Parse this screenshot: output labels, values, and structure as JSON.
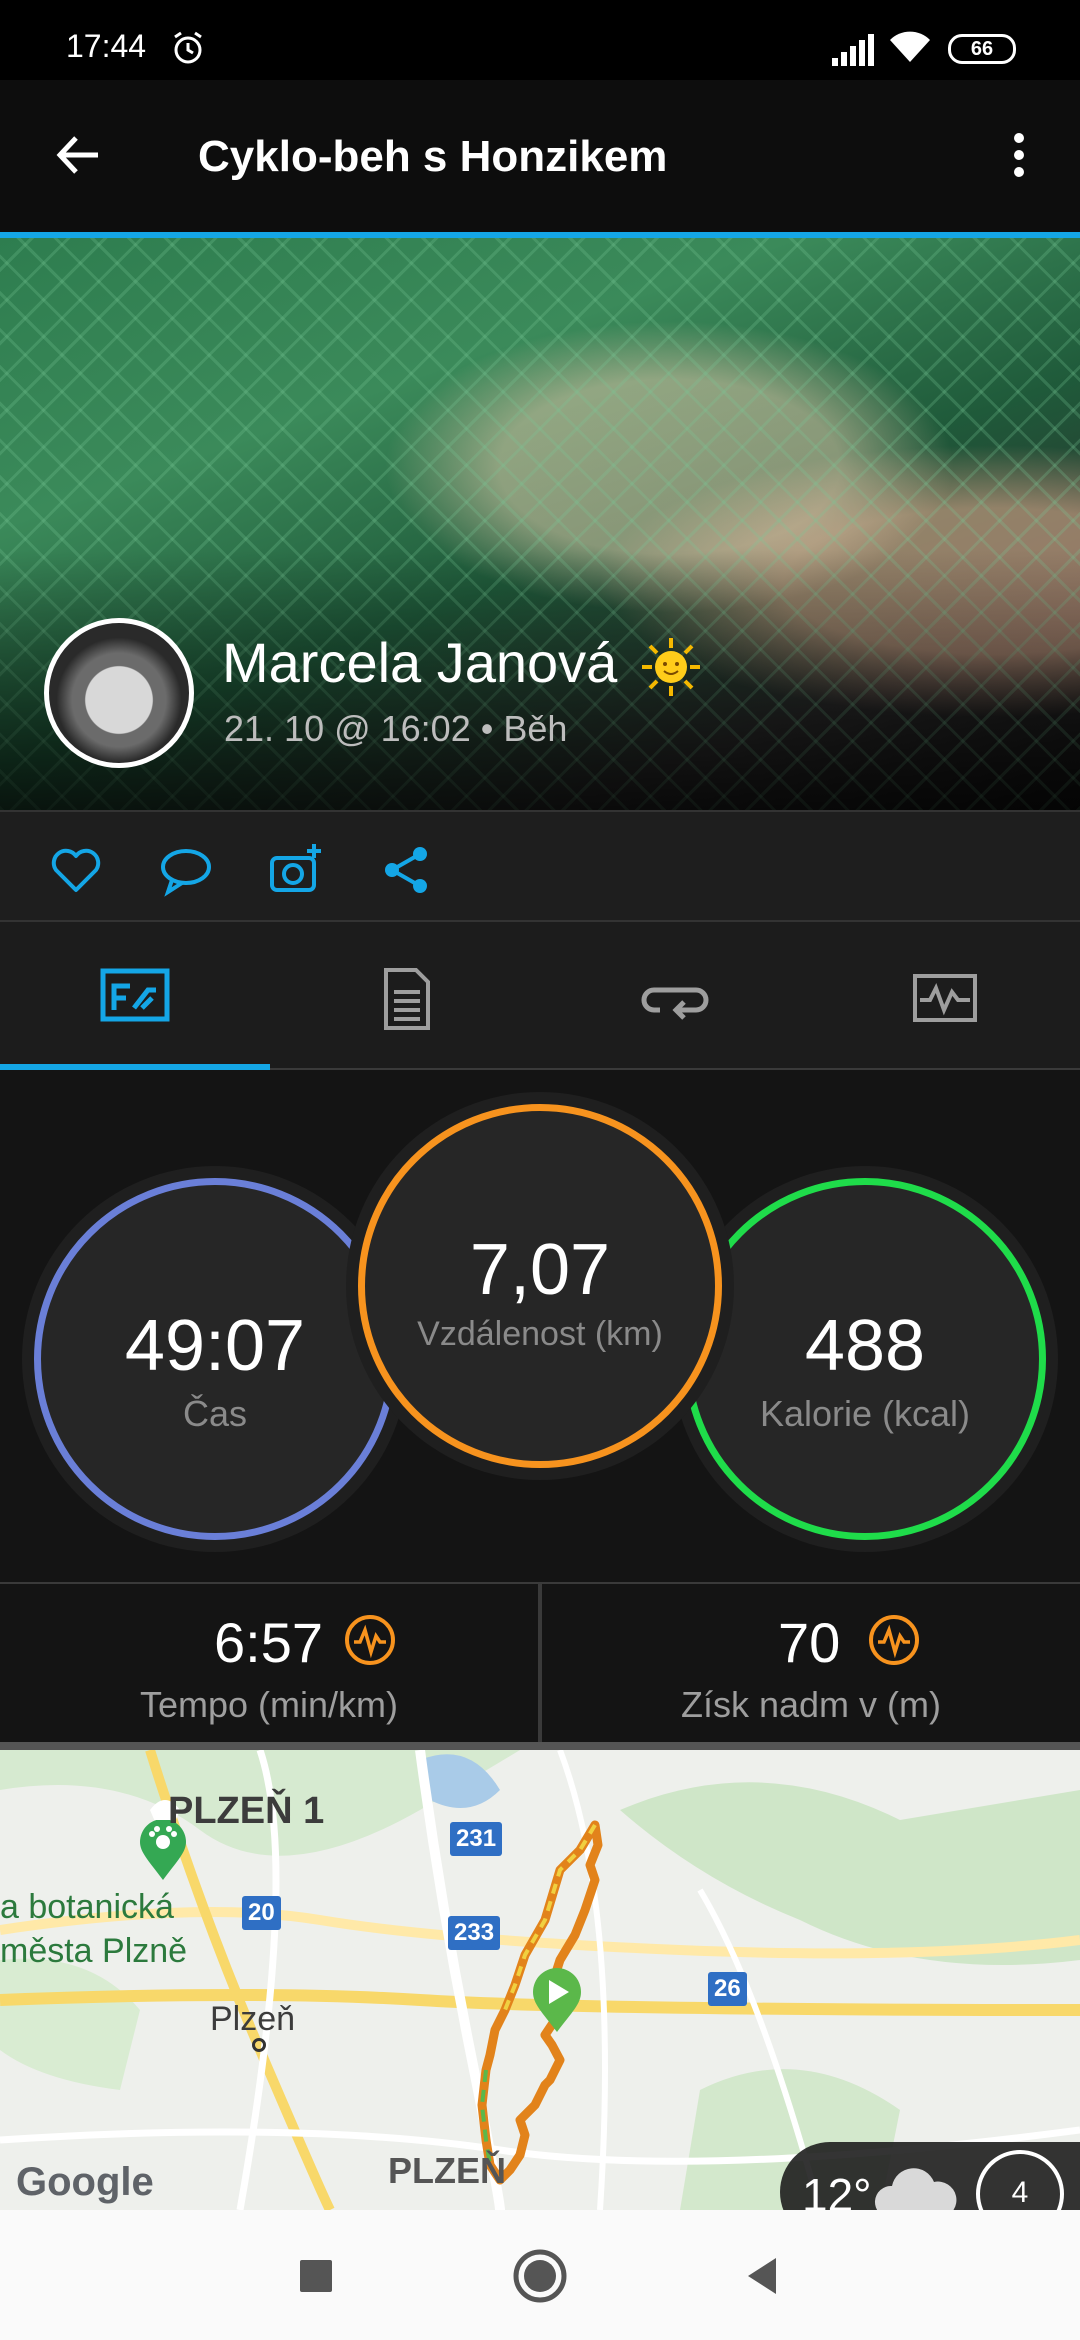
{
  "status_bar": {
    "time": "17:44",
    "battery": "66"
  },
  "app_bar": {
    "title": "Cyklo-beh s Honzikem"
  },
  "header": {
    "user_name": "Marcela Janová",
    "meta": "21. 10 @ 16:02 • Běh"
  },
  "actions": [
    "like-icon",
    "comment-icon",
    "add-photo-icon",
    "share-icon"
  ],
  "tabs": [
    "stats-icon",
    "details-icon",
    "laps-icon",
    "charts-icon"
  ],
  "colors": {
    "accent": "#14a6e6",
    "time_ring": "#5a8fd8",
    "distance_ring": "#f7931e",
    "calories_ring": "#1fdc4a",
    "elevation_icon": "#f7931e"
  },
  "stats": {
    "time": {
      "value": "49:07",
      "label": "Čas"
    },
    "distance": {
      "value": "7,07",
      "label": "Vzdálenost (km)"
    },
    "calories": {
      "value": "488",
      "label": "Kalorie (kcal)"
    }
  },
  "substats": {
    "pace": {
      "value": "6:57",
      "label": "Tempo (min/km)"
    },
    "elevation": {
      "value": "70",
      "label": "Získ nadm v (m)"
    }
  },
  "map": {
    "labels": {
      "plzen1": "PLZEŇ 1",
      "botanic1": "a botanická",
      "botanic2": "města Plzně",
      "plzen": "Plzeň",
      "plzen_bottom": "PLZEŇ",
      "google": "Google"
    },
    "shields": {
      "r231": "231",
      "r20": "20",
      "r233": "233",
      "r26": "26"
    }
  },
  "weather": {
    "temp": "12°",
    "wind": "4"
  }
}
